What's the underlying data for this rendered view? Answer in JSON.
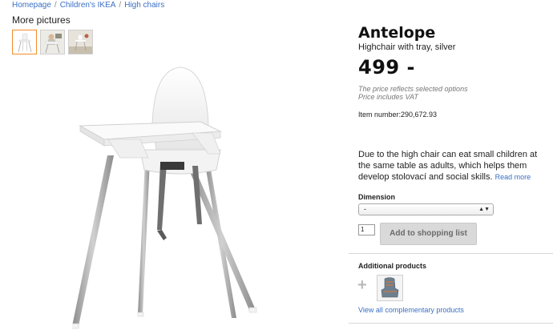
{
  "breadcrumb": {
    "items": [
      "Homepage",
      "Children's IKEA",
      "High chairs"
    ],
    "separator": "/"
  },
  "gallery": {
    "label": "More pictures",
    "thumbnails": [
      "highchair-front",
      "highchair-with-child",
      "highchair-in-room"
    ],
    "main_image": "highchair-with-tray-white-silver"
  },
  "product": {
    "name": "Antelope",
    "subtitle": "Highchair with tray, silver",
    "price": "499 -",
    "price_note": "The price reflects selected options",
    "vat_note": "Price includes VAT",
    "item_number": "Item number:290,672.93",
    "description": "Due to the high chair can eat small children at the same table as adults, which helps them develop stolovací and social skills.",
    "read_more": "Read more"
  },
  "purchase": {
    "dimension_label": "Dimension",
    "dimension_value": "-",
    "quantity": "1",
    "add_button": "Add to shopping list"
  },
  "additional": {
    "label": "Additional products",
    "plus_icon": "plus-icon",
    "items": [
      "highchair-cushion"
    ],
    "view_all": "View all complementary products"
  },
  "colors": {
    "link": "#3a6fc4",
    "thumb_active_border": "#f28c28",
    "button_bg": "#d9d9d9"
  }
}
